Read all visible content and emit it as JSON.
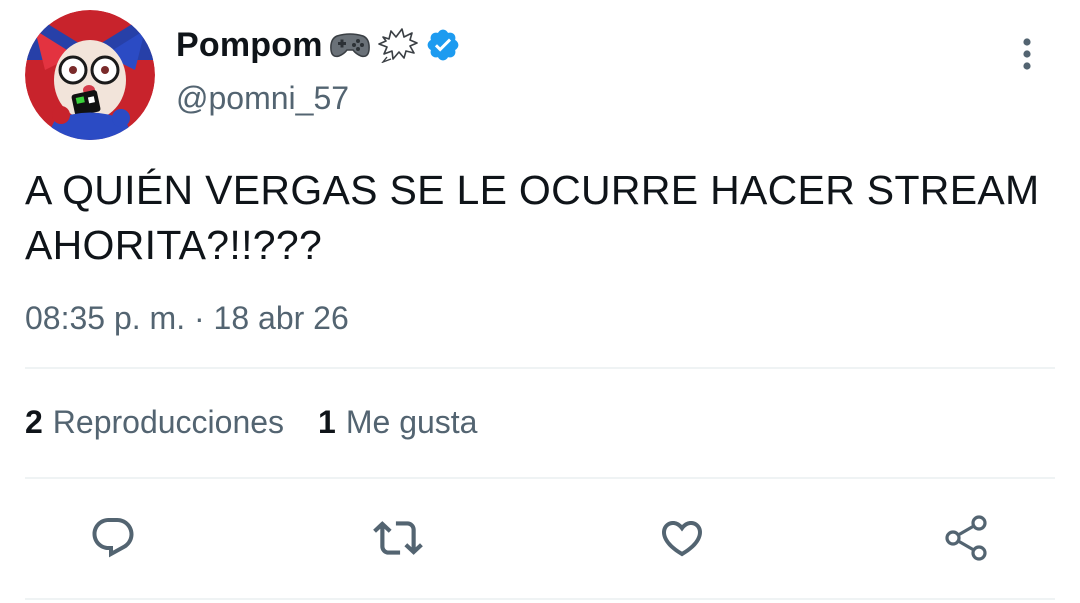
{
  "author": {
    "display_name": "Pompom",
    "handle": "@pomni_57",
    "name_emojis": [
      "game-controller-emoji",
      "anger-bubble-emoji"
    ],
    "verified": true,
    "verified_color": "#1d9bf0"
  },
  "tweet": {
    "line1": "A QUIÉN VERGAS SE LE OCURRE HACER STREAM",
    "line2": "AHORITA?!!???"
  },
  "meta": {
    "time": "08:35 p. m.",
    "separator": " · ",
    "date": "18 abr 26"
  },
  "stats": [
    {
      "count": "2",
      "label": "Reproducciones"
    },
    {
      "count": "1",
      "label": "Me gusta"
    }
  ],
  "actions": [
    "reply-icon",
    "retweet-icon",
    "like-icon",
    "share-icon"
  ],
  "colors": {
    "text": "#0f1419",
    "secondary": "#536471",
    "divider": "#eff3f4",
    "icon": "#536471"
  }
}
